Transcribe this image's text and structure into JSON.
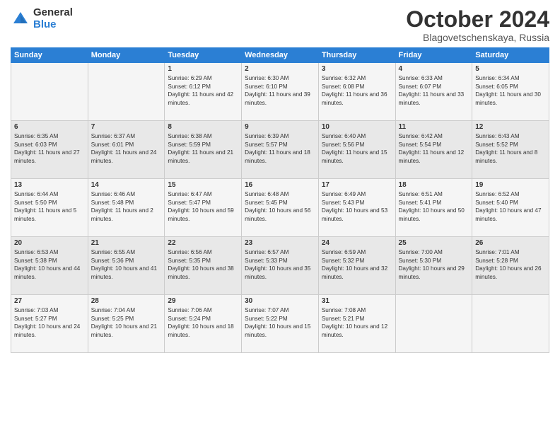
{
  "header": {
    "logo_general": "General",
    "logo_blue": "Blue",
    "month": "October 2024",
    "location": "Blagovetschenskaya, Russia"
  },
  "days_of_week": [
    "Sunday",
    "Monday",
    "Tuesday",
    "Wednesday",
    "Thursday",
    "Friday",
    "Saturday"
  ],
  "weeks": [
    [
      {
        "day": "",
        "info": ""
      },
      {
        "day": "",
        "info": ""
      },
      {
        "day": "1",
        "info": "Sunrise: 6:29 AM\nSunset: 6:12 PM\nDaylight: 11 hours and 42 minutes."
      },
      {
        "day": "2",
        "info": "Sunrise: 6:30 AM\nSunset: 6:10 PM\nDaylight: 11 hours and 39 minutes."
      },
      {
        "day": "3",
        "info": "Sunrise: 6:32 AM\nSunset: 6:08 PM\nDaylight: 11 hours and 36 minutes."
      },
      {
        "day": "4",
        "info": "Sunrise: 6:33 AM\nSunset: 6:07 PM\nDaylight: 11 hours and 33 minutes."
      },
      {
        "day": "5",
        "info": "Sunrise: 6:34 AM\nSunset: 6:05 PM\nDaylight: 11 hours and 30 minutes."
      }
    ],
    [
      {
        "day": "6",
        "info": "Sunrise: 6:35 AM\nSunset: 6:03 PM\nDaylight: 11 hours and 27 minutes."
      },
      {
        "day": "7",
        "info": "Sunrise: 6:37 AM\nSunset: 6:01 PM\nDaylight: 11 hours and 24 minutes."
      },
      {
        "day": "8",
        "info": "Sunrise: 6:38 AM\nSunset: 5:59 PM\nDaylight: 11 hours and 21 minutes."
      },
      {
        "day": "9",
        "info": "Sunrise: 6:39 AM\nSunset: 5:57 PM\nDaylight: 11 hours and 18 minutes."
      },
      {
        "day": "10",
        "info": "Sunrise: 6:40 AM\nSunset: 5:56 PM\nDaylight: 11 hours and 15 minutes."
      },
      {
        "day": "11",
        "info": "Sunrise: 6:42 AM\nSunset: 5:54 PM\nDaylight: 11 hours and 12 minutes."
      },
      {
        "day": "12",
        "info": "Sunrise: 6:43 AM\nSunset: 5:52 PM\nDaylight: 11 hours and 8 minutes."
      }
    ],
    [
      {
        "day": "13",
        "info": "Sunrise: 6:44 AM\nSunset: 5:50 PM\nDaylight: 11 hours and 5 minutes."
      },
      {
        "day": "14",
        "info": "Sunrise: 6:46 AM\nSunset: 5:48 PM\nDaylight: 11 hours and 2 minutes."
      },
      {
        "day": "15",
        "info": "Sunrise: 6:47 AM\nSunset: 5:47 PM\nDaylight: 10 hours and 59 minutes."
      },
      {
        "day": "16",
        "info": "Sunrise: 6:48 AM\nSunset: 5:45 PM\nDaylight: 10 hours and 56 minutes."
      },
      {
        "day": "17",
        "info": "Sunrise: 6:49 AM\nSunset: 5:43 PM\nDaylight: 10 hours and 53 minutes."
      },
      {
        "day": "18",
        "info": "Sunrise: 6:51 AM\nSunset: 5:41 PM\nDaylight: 10 hours and 50 minutes."
      },
      {
        "day": "19",
        "info": "Sunrise: 6:52 AM\nSunset: 5:40 PM\nDaylight: 10 hours and 47 minutes."
      }
    ],
    [
      {
        "day": "20",
        "info": "Sunrise: 6:53 AM\nSunset: 5:38 PM\nDaylight: 10 hours and 44 minutes."
      },
      {
        "day": "21",
        "info": "Sunrise: 6:55 AM\nSunset: 5:36 PM\nDaylight: 10 hours and 41 minutes."
      },
      {
        "day": "22",
        "info": "Sunrise: 6:56 AM\nSunset: 5:35 PM\nDaylight: 10 hours and 38 minutes."
      },
      {
        "day": "23",
        "info": "Sunrise: 6:57 AM\nSunset: 5:33 PM\nDaylight: 10 hours and 35 minutes."
      },
      {
        "day": "24",
        "info": "Sunrise: 6:59 AM\nSunset: 5:32 PM\nDaylight: 10 hours and 32 minutes."
      },
      {
        "day": "25",
        "info": "Sunrise: 7:00 AM\nSunset: 5:30 PM\nDaylight: 10 hours and 29 minutes."
      },
      {
        "day": "26",
        "info": "Sunrise: 7:01 AM\nSunset: 5:28 PM\nDaylight: 10 hours and 26 minutes."
      }
    ],
    [
      {
        "day": "27",
        "info": "Sunrise: 7:03 AM\nSunset: 5:27 PM\nDaylight: 10 hours and 24 minutes."
      },
      {
        "day": "28",
        "info": "Sunrise: 7:04 AM\nSunset: 5:25 PM\nDaylight: 10 hours and 21 minutes."
      },
      {
        "day": "29",
        "info": "Sunrise: 7:06 AM\nSunset: 5:24 PM\nDaylight: 10 hours and 18 minutes."
      },
      {
        "day": "30",
        "info": "Sunrise: 7:07 AM\nSunset: 5:22 PM\nDaylight: 10 hours and 15 minutes."
      },
      {
        "day": "31",
        "info": "Sunrise: 7:08 AM\nSunset: 5:21 PM\nDaylight: 10 hours and 12 minutes."
      },
      {
        "day": "",
        "info": ""
      },
      {
        "day": "",
        "info": ""
      }
    ]
  ]
}
